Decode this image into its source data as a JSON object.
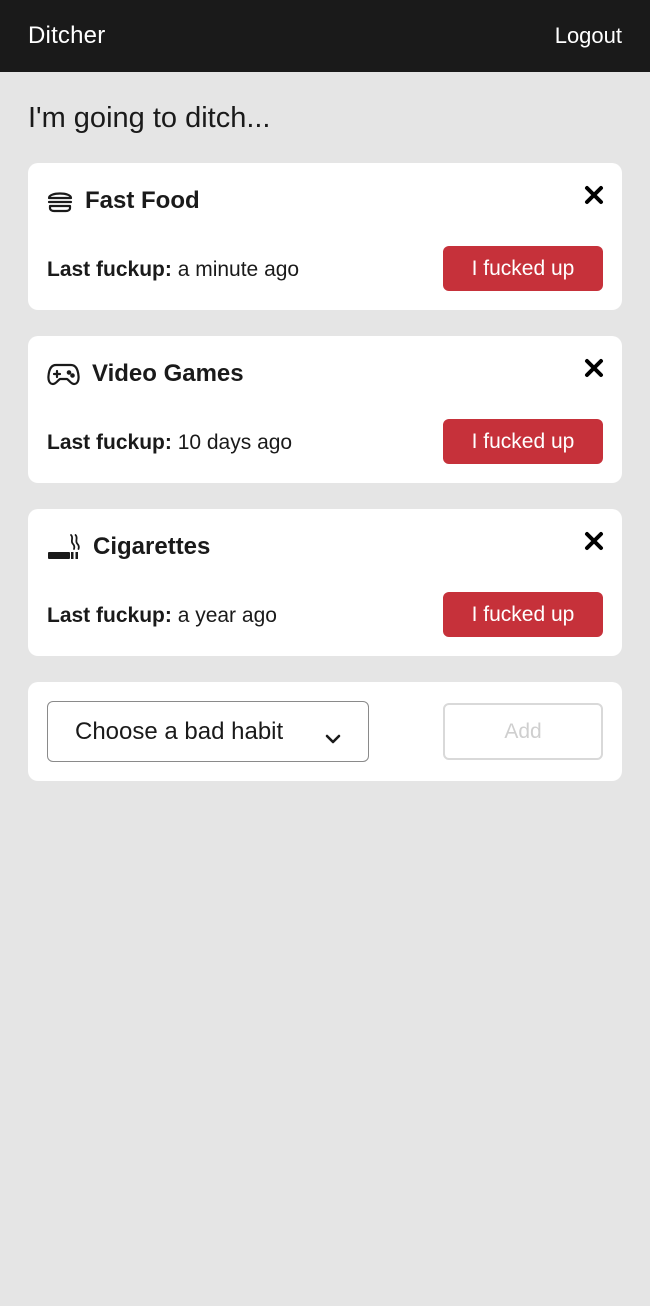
{
  "nav": {
    "brand": "Ditcher",
    "logout_label": "Logout"
  },
  "heading": "I'm going to ditch...",
  "habits": [
    {
      "icon": "burger-icon",
      "name": "Fast Food",
      "last_label": "Last fuckup:",
      "last_value": "a minute ago",
      "button_label": "I fucked up"
    },
    {
      "icon": "gamepad-icon",
      "name": "Video Games",
      "last_label": "Last fuckup:",
      "last_value": "10 days ago",
      "button_label": "I fucked up"
    },
    {
      "icon": "smoking-icon",
      "name": "Cigarettes",
      "last_label": "Last fuckup:",
      "last_value": "a year ago",
      "button_label": "I fucked up"
    }
  ],
  "add_form": {
    "select_value": "Choose a bad habit",
    "add_label": "Add"
  },
  "colors": {
    "navbar": "#1a1a1a",
    "background": "#e5e5e5",
    "danger": "#c6313a",
    "card": "#ffffff"
  }
}
